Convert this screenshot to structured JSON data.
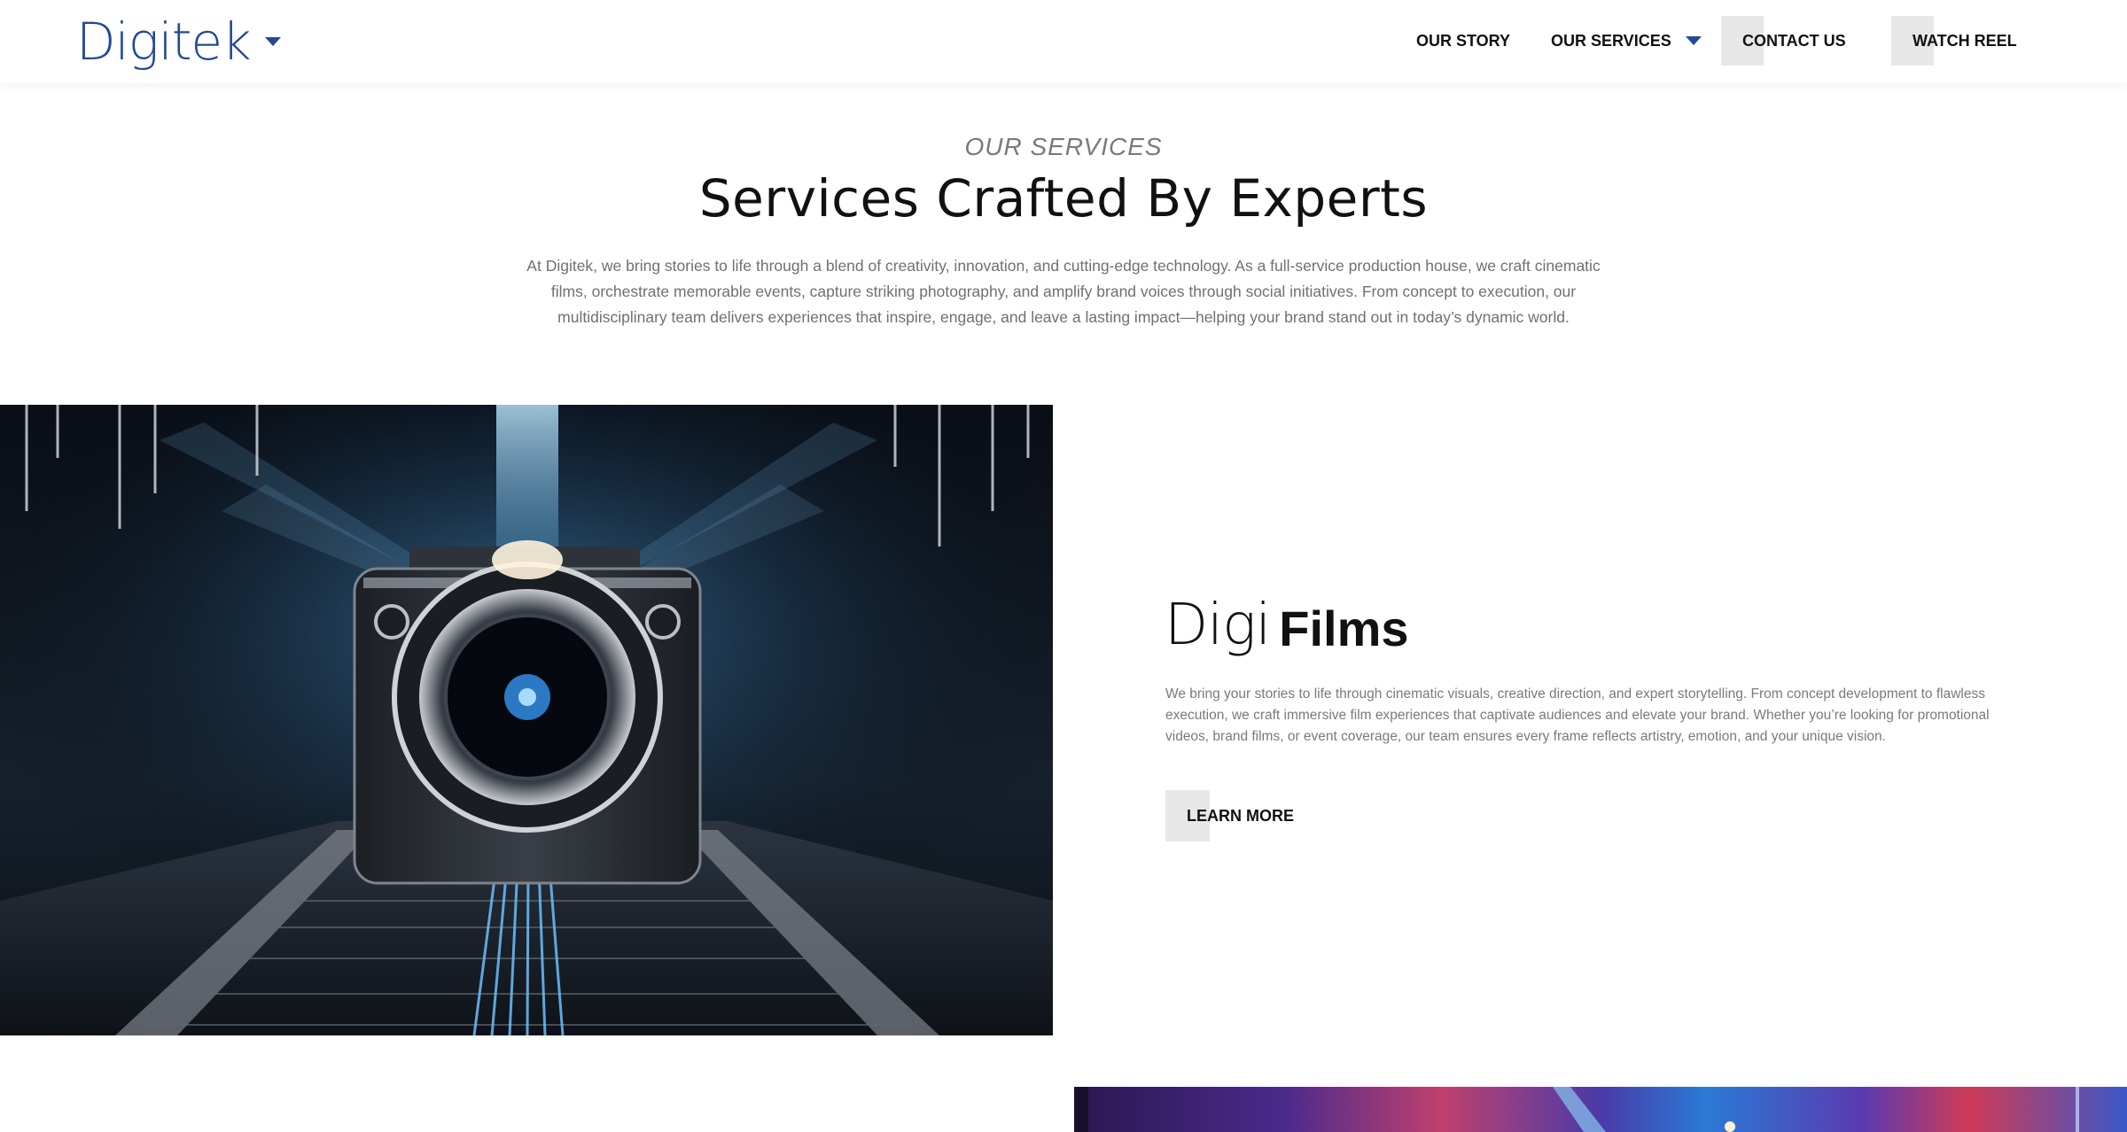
{
  "header": {
    "logo_text": "Digitek",
    "nav": [
      {
        "label": "OUR STORY"
      },
      {
        "label": "OUR SERVICES"
      },
      {
        "label": "CONTACT US"
      },
      {
        "label": "WATCH REEL"
      }
    ]
  },
  "intro": {
    "eyebrow": "OUR SERVICES",
    "headline": "Services Crafted By Experts",
    "body": "At Digitek, we bring stories to life through a blend of creativity, innovation, and cutting-edge technology. As a full-service production house, we craft cinematic films, orchestrate memorable events, capture striking photography, and amplify brand voices through social initiatives. From concept to execution, our multidisciplinary team delivers experiences that inspire, engage, and leave a lasting impact—helping your brand stand out in today’s dynamic world."
  },
  "service_films": {
    "logo_light": "Digi",
    "logo_bold": "Films",
    "description": "We bring your stories to life through cinematic visuals, creative direction, and expert storytelling. From concept development to flawless execution, we craft immersive film experiences that captivate audiences and elevate your brand. Whether you’re looking for promotional videos, brand films, or event coverage, our team ensures every frame reflects artistry, emotion, and your unique vision.",
    "cta": "LEARN MORE"
  },
  "colors": {
    "brand_blue": "#234a98",
    "button_grey": "#e7e7e7",
    "body_grey": "#707070"
  },
  "icons": {
    "logo_dropdown": "caret-down-icon",
    "services_dropdown": "caret-down-icon"
  }
}
